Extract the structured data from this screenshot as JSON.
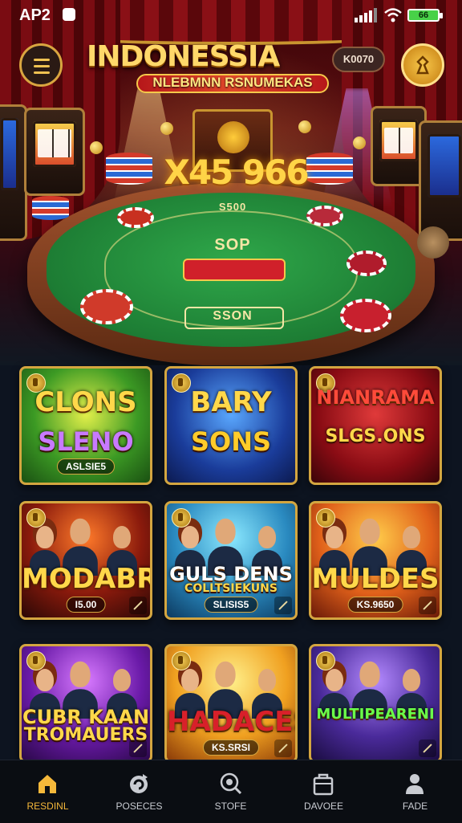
{
  "status_bar": {
    "carrier": "AP2",
    "battery": "66"
  },
  "header": {
    "title": "INDONESSIA",
    "subtitle": "NLEBMNN RSNUMEKAS",
    "balance": "K0070"
  },
  "hero": {
    "jackpot": "X45 966",
    "felt_top_label": "S500",
    "felt_center_label": "SOP",
    "felt_bottom_label": "SSON"
  },
  "games": [
    {
      "line1": "CLONS",
      "line2": "SLENO",
      "tag": "ASLSIE5",
      "theme": "green"
    },
    {
      "line1": "BARY",
      "line2": "SONS",
      "tag": "",
      "theme": "blue"
    },
    {
      "line1": "NIANRAMA",
      "line2": "SLGS.ONS",
      "tag": "",
      "theme": "red"
    },
    {
      "line1": "MODABR",
      "line2": "",
      "tag": "I5.00",
      "theme": "dark"
    },
    {
      "line1": "GULS DENS",
      "line2": "COLLTSIEKUNS",
      "tag": "SLISIS5",
      "theme": "teal"
    },
    {
      "line1": "MULDES",
      "line2": "",
      "tag": "KS.9650",
      "theme": "orange"
    },
    {
      "line1": "CUBR KAAN",
      "line2": "TROMAUERS",
      "tag": "",
      "theme": "purple"
    },
    {
      "line1": "HADACES",
      "line2": "",
      "tag": "KS.SRSI",
      "theme": "gold"
    },
    {
      "line1": "MULTIPEARENI",
      "line2": "",
      "tag": "",
      "theme": "violet"
    }
  ],
  "nav": [
    {
      "label": "RESDINL",
      "icon": "home-icon",
      "active": true
    },
    {
      "label": "POSECES",
      "icon": "refresh-icon",
      "active": false
    },
    {
      "label": "STOFE",
      "icon": "search-icon",
      "active": false
    },
    {
      "label": "DAVOEE",
      "icon": "bag-icon",
      "active": false
    },
    {
      "label": "FADE",
      "icon": "profile-icon",
      "active": false
    }
  ],
  "colors": {
    "accent": "#f5b83a",
    "felt": "#1d7d34",
    "frame": "#d4a640"
  }
}
